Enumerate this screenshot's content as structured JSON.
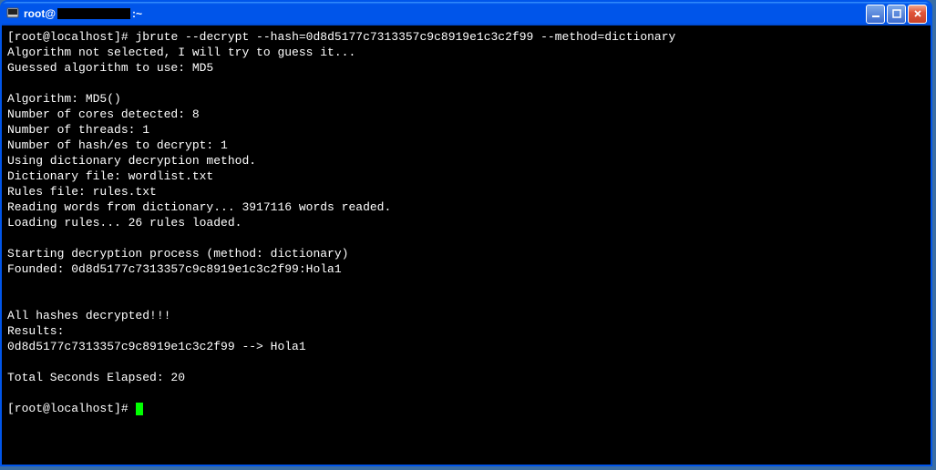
{
  "window": {
    "title_prefix": "root@",
    "title_suffix": ":~"
  },
  "terminal": {
    "prompt": "[root@localhost]# ",
    "command": "jbrute --decrypt --hash=0d8d5177c7313357c9c8919e1c3c2f99 --method=dictionary",
    "lines": [
      "Algorithm not selected, I will try to guess it...",
      "Guessed algorithm to use: MD5",
      "",
      "Algorithm: MD5()",
      "Number of cores detected: 8",
      "Number of threads: 1",
      "Number of hash/es to decrypt: 1",
      "Using dictionary decryption method.",
      "Dictionary file: wordlist.txt",
      "Rules file: rules.txt",
      "Reading words from dictionary... 3917116 words readed.",
      "Loading rules... 26 rules loaded.",
      "",
      "Starting decryption process (method: dictionary)",
      "Founded: 0d8d5177c7313357c9c8919e1c3c2f99:Hola1",
      "",
      "",
      "All hashes decrypted!!!",
      "Results:",
      "0d8d5177c7313357c9c8919e1c3c2f99 --> Hola1",
      "",
      "Total Seconds Elapsed: 20",
      ""
    ],
    "prompt2": "[root@localhost]# "
  }
}
